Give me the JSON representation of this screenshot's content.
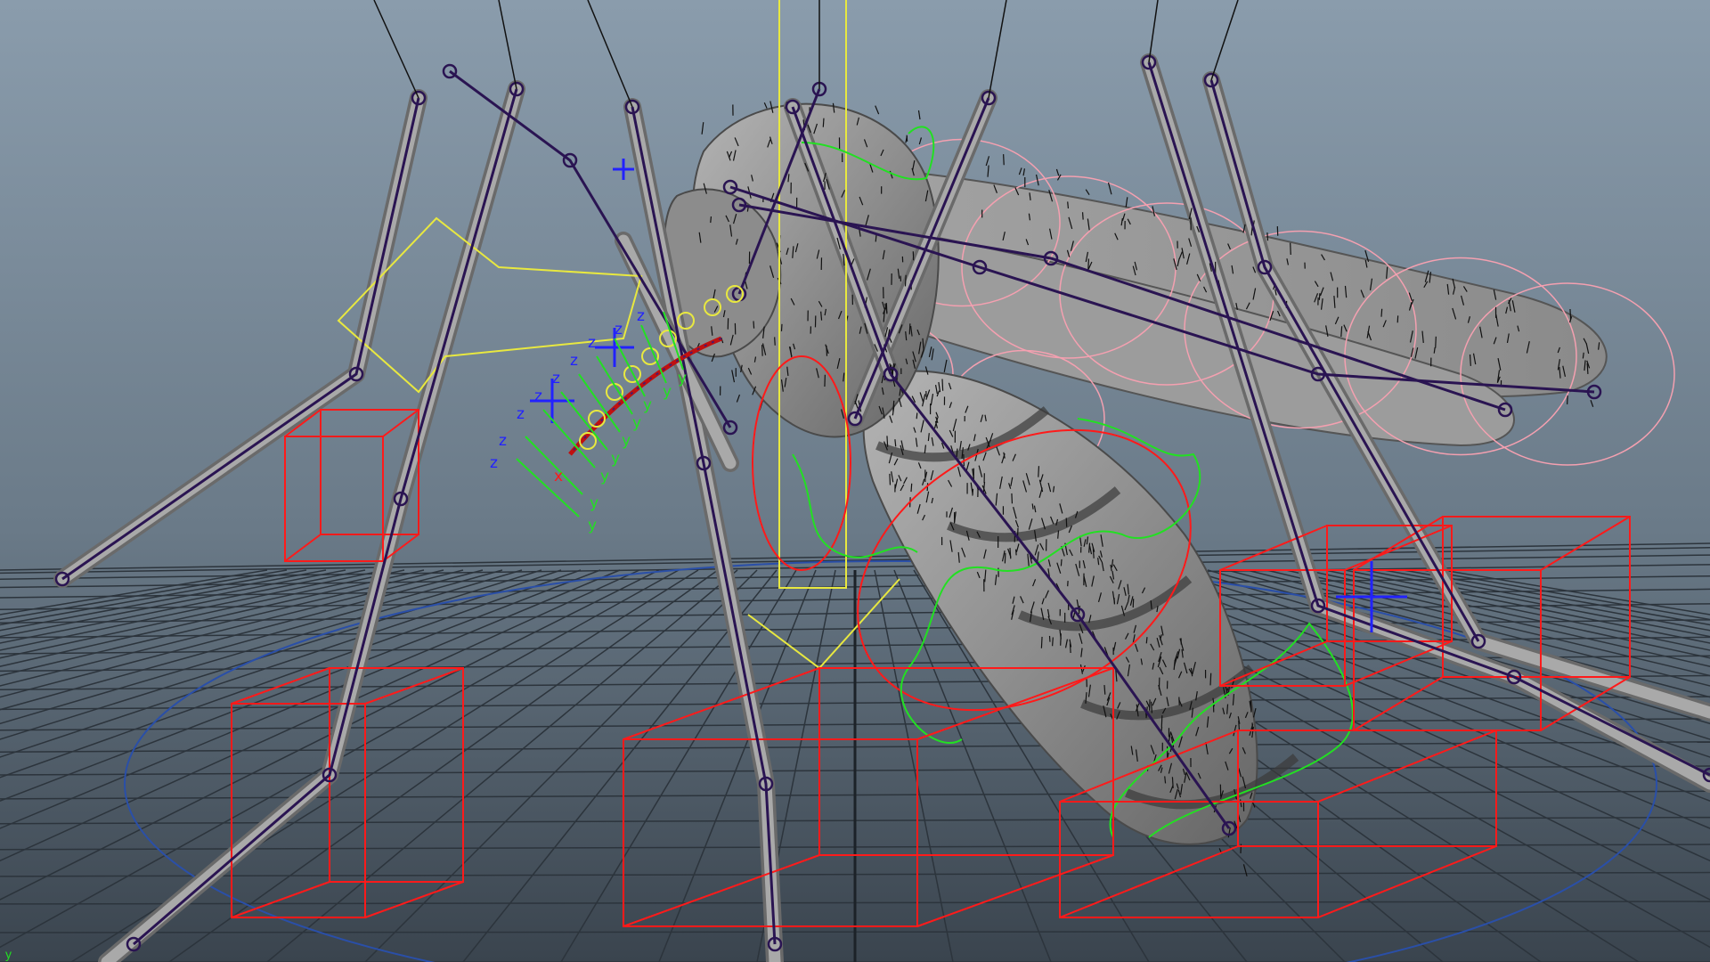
{
  "viewport": {
    "title": "",
    "subject": "mosquito rig",
    "background": {
      "top": "#8a9cac",
      "mid": "#6a7a88",
      "bottom": "#3a444e"
    },
    "colors": {
      "grid": "#2c343c",
      "grid_axis": "#1c2228",
      "body": "#9a9a9a",
      "body_dark": "#5c5c5c",
      "joint": "#2a1452",
      "control_curve": "#ff1a1a",
      "ik_curve": "#22e022",
      "locator": "#2222ff",
      "handle": "#e8e840",
      "wing_circle": "#f4a0b0",
      "global_circle": "#2a4fa8"
    },
    "axis_labels": {
      "z": "z",
      "y": "y",
      "x": "x"
    },
    "corner_axis_label": "y"
  }
}
